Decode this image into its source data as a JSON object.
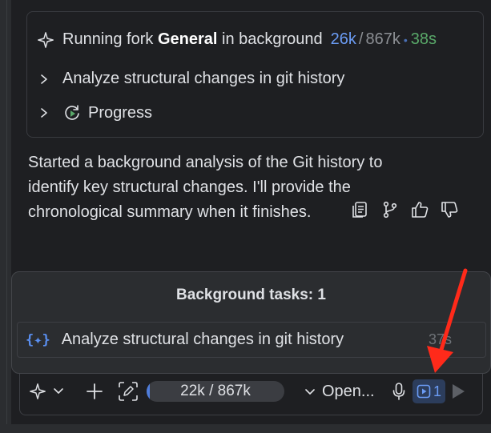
{
  "fork": {
    "prefix": "Running fork",
    "name": "General",
    "suffix": "in background",
    "tokens_used": "26k",
    "separator": "/",
    "tokens_total": "867k",
    "elapsed": "38s"
  },
  "subitems": [
    {
      "label": "Analyze structural changes in git history"
    },
    {
      "label": "Progress"
    }
  ],
  "message": {
    "text": "Started a background analysis of the Git history to identify key structural changes. I'll provide the chronological summary when it finishes."
  },
  "background_tasks": {
    "title": "Background tasks: 1",
    "task_icon": "{✦}",
    "task_label": "Analyze structural changes in git history",
    "task_time": "37s"
  },
  "toolbar": {
    "token_usage": "22k / 867k",
    "token_fraction": 0.025,
    "model_label": "Open...",
    "bg_task_count": "1"
  },
  "colors": {
    "accent": "#6b9cf5",
    "elapsed": "#59a869",
    "arrow": "#ff2a1a"
  }
}
